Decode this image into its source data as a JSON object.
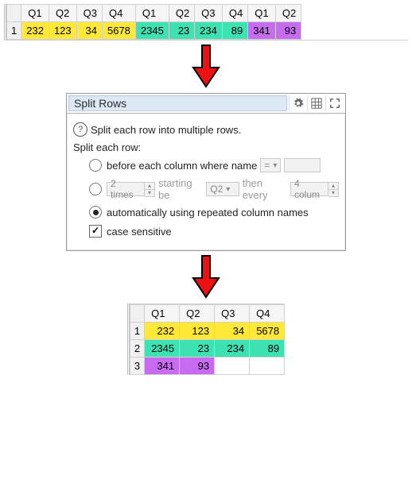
{
  "top_table": {
    "headers": [
      "Q1",
      "Q2",
      "Q3",
      "Q4",
      "Q1",
      "Q2",
      "Q3",
      "Q4",
      "Q1",
      "Q2"
    ],
    "rownum": "1",
    "cells": [
      {
        "v": "232",
        "c": "yellow"
      },
      {
        "v": "123",
        "c": "yellow"
      },
      {
        "v": "34",
        "c": "yellow"
      },
      {
        "v": "5678",
        "c": "yellow"
      },
      {
        "v": "2345",
        "c": "teal"
      },
      {
        "v": "23",
        "c": "teal"
      },
      {
        "v": "234",
        "c": "teal"
      },
      {
        "v": "89",
        "c": "teal"
      },
      {
        "v": "341",
        "c": "purple"
      },
      {
        "v": "93",
        "c": "purple"
      }
    ]
  },
  "dialog": {
    "title": "Split Rows",
    "desc": "Split each row into multiple rows.",
    "label_split_each_row": "Split each row:",
    "opt1_label": "before each column where name",
    "opt1_op": "=",
    "opt1_value": "",
    "opt2_times": "2 times",
    "opt2_mid": "starting be",
    "opt2_col": "Q2",
    "opt2_then": "then every",
    "opt2_every": "4 colum",
    "opt3_label": "automatically using repeated column names",
    "case_label": "case sensitive"
  },
  "bottom_table": {
    "headers": [
      "Q1",
      "Q2",
      "Q3",
      "Q4"
    ],
    "rows": [
      {
        "n": "1",
        "cells": [
          {
            "v": "232",
            "c": "yellow"
          },
          {
            "v": "123",
            "c": "yellow"
          },
          {
            "v": "34",
            "c": "yellow"
          },
          {
            "v": "5678",
            "c": "yellow"
          }
        ]
      },
      {
        "n": "2",
        "cells": [
          {
            "v": "2345",
            "c": "teal"
          },
          {
            "v": "23",
            "c": "teal"
          },
          {
            "v": "234",
            "c": "teal"
          },
          {
            "v": "89",
            "c": "teal"
          }
        ]
      },
      {
        "n": "3",
        "cells": [
          {
            "v": "341",
            "c": "purple"
          },
          {
            "v": "93",
            "c": "purple"
          },
          {
            "v": "",
            "c": ""
          },
          {
            "v": "",
            "c": ""
          }
        ]
      }
    ]
  }
}
